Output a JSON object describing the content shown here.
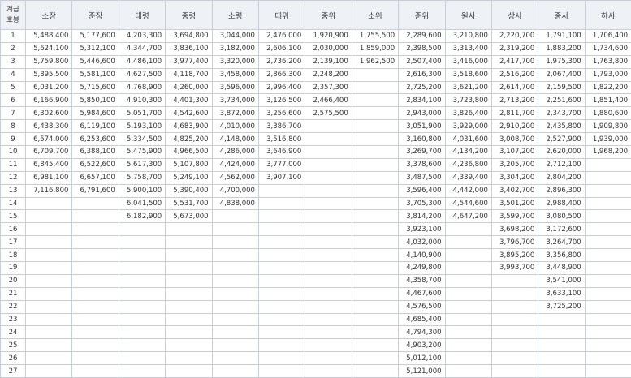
{
  "table": {
    "corner_line1": "계급",
    "corner_line2": "호봉",
    "ranks": [
      "소장",
      "준장",
      "대령",
      "중령",
      "소령",
      "대위",
      "중위",
      "소위",
      "준위",
      "원사",
      "상사",
      "중사",
      "하사"
    ],
    "rows": [
      {
        "grade": "1",
        "cells": [
          "5,488,400",
          "5,177,600",
          "4,203,300",
          "3,694,800",
          "3,044,000",
          "2,476,000",
          "1,920,900",
          "1,755,500",
          "2,289,600",
          "3,210,800",
          "2,220,700",
          "1,791,100",
          "1,706,400"
        ]
      },
      {
        "grade": "2",
        "cells": [
          "5,624,100",
          "5,312,100",
          "4,344,700",
          "3,836,100",
          "3,182,000",
          "2,606,100",
          "2,030,000",
          "1,859,000",
          "2,398,500",
          "3,313,400",
          "2,319,200",
          "1,883,200",
          "1,734,600"
        ]
      },
      {
        "grade": "3",
        "cells": [
          "5,759,800",
          "5,446,600",
          "4,486,100",
          "3,977,400",
          "3,320,000",
          "2,736,200",
          "2,139,100",
          "1,962,500",
          "2,507,400",
          "3,416,000",
          "2,417,700",
          "1,975,300",
          "1,763,800"
        ]
      },
      {
        "grade": "4",
        "cells": [
          "5,895,500",
          "5,581,100",
          "4,627,500",
          "4,118,700",
          "3,458,000",
          "2,866,300",
          "2,248,200",
          "",
          "2,616,300",
          "3,518,600",
          "2,516,200",
          "2,067,400",
          "1,793,000"
        ]
      },
      {
        "grade": "5",
        "cells": [
          "6,031,200",
          "5,715,600",
          "4,768,900",
          "4,260,000",
          "3,596,000",
          "2,996,400",
          "2,357,300",
          "",
          "2,725,200",
          "3,621,200",
          "2,614,700",
          "2,159,500",
          "1,822,200"
        ]
      },
      {
        "grade": "6",
        "cells": [
          "6,166,900",
          "5,850,100",
          "4,910,300",
          "4,401,300",
          "3,734,000",
          "3,126,500",
          "2,466,400",
          "",
          "2,834,100",
          "3,723,800",
          "2,713,200",
          "2,251,600",
          "1,851,400"
        ]
      },
      {
        "grade": "7",
        "cells": [
          "6,302,600",
          "5,984,600",
          "5,051,700",
          "4,542,600",
          "3,872,000",
          "3,256,600",
          "2,575,500",
          "",
          "2,943,000",
          "3,826,400",
          "2,811,700",
          "2,343,700",
          "1,880,600"
        ]
      },
      {
        "grade": "8",
        "cells": [
          "6,438,300",
          "6,119,100",
          "5,193,100",
          "4,683,900",
          "4,010,000",
          "3,386,700",
          "",
          "",
          "3,051,900",
          "3,929,000",
          "2,910,200",
          "2,435,800",
          "1,909,800"
        ]
      },
      {
        "grade": "9",
        "cells": [
          "6,574,000",
          "6,253,600",
          "5,334,500",
          "4,825,200",
          "4,148,000",
          "3,516,800",
          "",
          "",
          "3,160,800",
          "4,031,600",
          "3,008,700",
          "2,527,900",
          "1,939,000"
        ]
      },
      {
        "grade": "10",
        "cells": [
          "6,709,700",
          "6,388,100",
          "5,475,900",
          "4,966,500",
          "4,286,000",
          "3,646,900",
          "",
          "",
          "3,269,700",
          "4,134,200",
          "3,107,200",
          "2,620,000",
          "1,968,200"
        ]
      },
      {
        "grade": "11",
        "cells": [
          "6,845,400",
          "6,522,600",
          "5,617,300",
          "5,107,800",
          "4,424,000",
          "3,777,000",
          "",
          "",
          "3,378,600",
          "4,236,800",
          "3,205,700",
          "2,712,100",
          ""
        ]
      },
      {
        "grade": "12",
        "cells": [
          "6,981,100",
          "6,657,100",
          "5,758,700",
          "5,249,100",
          "4,562,000",
          "3,907,100",
          "",
          "",
          "3,487,500",
          "4,339,400",
          "3,304,200",
          "2,804,200",
          ""
        ]
      },
      {
        "grade": "13",
        "cells": [
          "7,116,800",
          "6,791,600",
          "5,900,100",
          "5,390,400",
          "4,700,000",
          "",
          "",
          "",
          "3,596,400",
          "4,442,000",
          "3,402,700",
          "2,896,300",
          ""
        ]
      },
      {
        "grade": "14",
        "cells": [
          "",
          "",
          "6,041,500",
          "5,531,700",
          "4,838,000",
          "",
          "",
          "",
          "3,705,300",
          "4,544,600",
          "3,501,200",
          "2,988,400",
          ""
        ]
      },
      {
        "grade": "15",
        "cells": [
          "",
          "",
          "6,182,900",
          "5,673,000",
          "",
          "",
          "",
          "",
          "3,814,200",
          "4,647,200",
          "3,599,700",
          "3,080,500",
          ""
        ]
      },
      {
        "grade": "16",
        "cells": [
          "",
          "",
          "",
          "",
          "",
          "",
          "",
          "",
          "3,923,100",
          "",
          "3,698,200",
          "3,172,600",
          ""
        ]
      },
      {
        "grade": "17",
        "cells": [
          "",
          "",
          "",
          "",
          "",
          "",
          "",
          "",
          "4,032,000",
          "",
          "3,796,700",
          "3,264,700",
          ""
        ]
      },
      {
        "grade": "18",
        "cells": [
          "",
          "",
          "",
          "",
          "",
          "",
          "",
          "",
          "4,140,900",
          "",
          "3,895,200",
          "3,356,800",
          ""
        ]
      },
      {
        "grade": "19",
        "cells": [
          "",
          "",
          "",
          "",
          "",
          "",
          "",
          "",
          "4,249,800",
          "",
          "3,993,700",
          "3,448,900",
          ""
        ]
      },
      {
        "grade": "20",
        "cells": [
          "",
          "",
          "",
          "",
          "",
          "",
          "",
          "",
          "4,358,700",
          "",
          "",
          "3,541,000",
          ""
        ]
      },
      {
        "grade": "21",
        "cells": [
          "",
          "",
          "",
          "",
          "",
          "",
          "",
          "",
          "4,467,600",
          "",
          "",
          "3,633,100",
          ""
        ]
      },
      {
        "grade": "22",
        "cells": [
          "",
          "",
          "",
          "",
          "",
          "",
          "",
          "",
          "4,576,500",
          "",
          "",
          "3,725,200",
          ""
        ]
      },
      {
        "grade": "23",
        "cells": [
          "",
          "",
          "",
          "",
          "",
          "",
          "",
          "",
          "4,685,400",
          "",
          "",
          "",
          ""
        ]
      },
      {
        "grade": "24",
        "cells": [
          "",
          "",
          "",
          "",
          "",
          "",
          "",
          "",
          "4,794,300",
          "",
          "",
          "",
          ""
        ]
      },
      {
        "grade": "25",
        "cells": [
          "",
          "",
          "",
          "",
          "",
          "",
          "",
          "",
          "4,903,200",
          "",
          "",
          "",
          ""
        ]
      },
      {
        "grade": "26",
        "cells": [
          "",
          "",
          "",
          "",
          "",
          "",
          "",
          "",
          "5,012,100",
          "",
          "",
          "",
          ""
        ]
      },
      {
        "grade": "27",
        "cells": [
          "",
          "",
          "",
          "",
          "",
          "",
          "",
          "",
          "5,121,000",
          "",
          "",
          "",
          ""
        ]
      }
    ]
  }
}
